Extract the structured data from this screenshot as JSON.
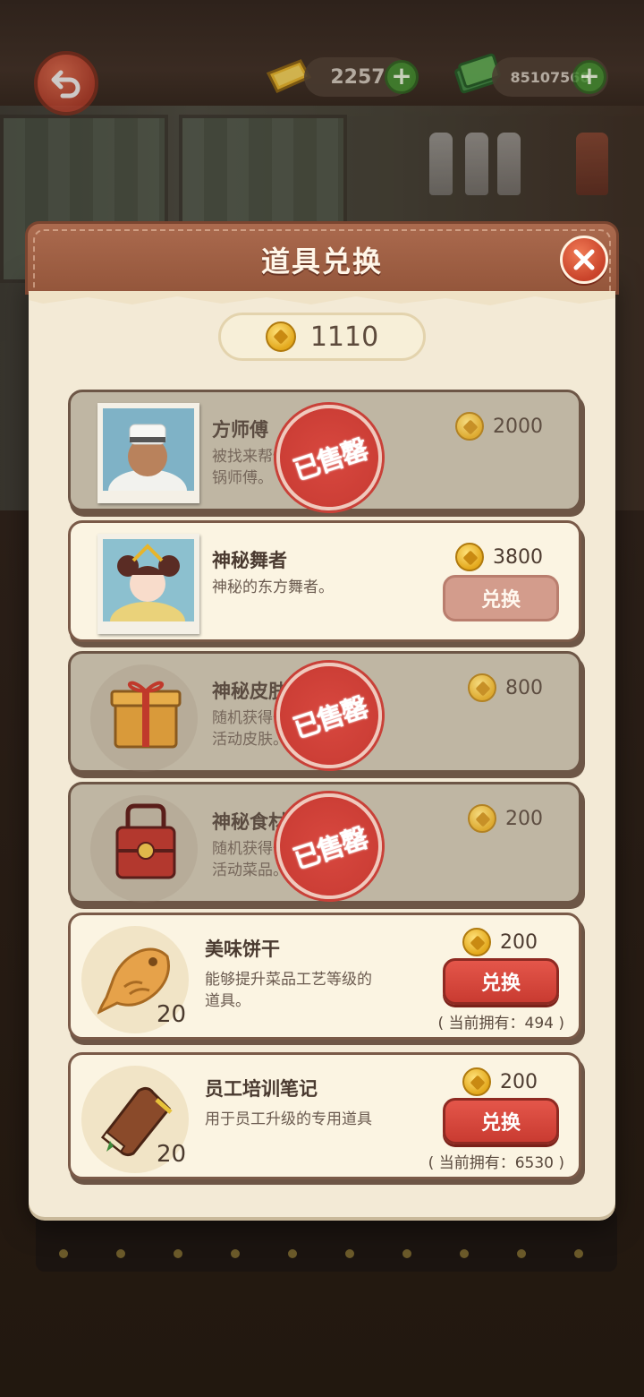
{
  "hud": {
    "gold_bar_value": "2257",
    "cash_value": "85107560"
  },
  "modal": {
    "title": "道具兑换",
    "balance": "1110"
  },
  "items": [
    {
      "name": "方师傅",
      "desc": "被找来帮忙的端\n锅师傅。",
      "price": "2000",
      "status": "已售罄",
      "sold": true
    },
    {
      "name": "神秘舞者",
      "desc": "神秘的东方舞者。",
      "price": "3800",
      "button": "兑换",
      "sold": false
    },
    {
      "name": "神秘皮肤",
      "desc": "随机获得一个的\n活动皮肤。",
      "price": "800",
      "status": "已售罄",
      "sold": true
    },
    {
      "name": "神秘食材",
      "desc": "随机获得一个的\n活动菜品。",
      "price": "200",
      "status": "已售罄",
      "sold": true
    },
    {
      "name": "美味饼干",
      "desc": "能够提升菜品工艺等级的\n道具。",
      "price": "200",
      "button": "兑换",
      "quantity": "20",
      "owned": "( 当前拥有：494 )",
      "sold": false
    },
    {
      "name": "员工培训笔记",
      "desc": "用于员工升级的专用道具",
      "price": "200",
      "button": "兑换",
      "quantity": "20",
      "owned": "( 当前拥有：6530 )",
      "sold": false
    }
  ],
  "colors": {
    "header_brown": "#94563b",
    "paper": "#f3ead6",
    "buy_red": "#c93b31",
    "stamp_red": "#c73a32",
    "coin_gold": "#e3a81c"
  }
}
